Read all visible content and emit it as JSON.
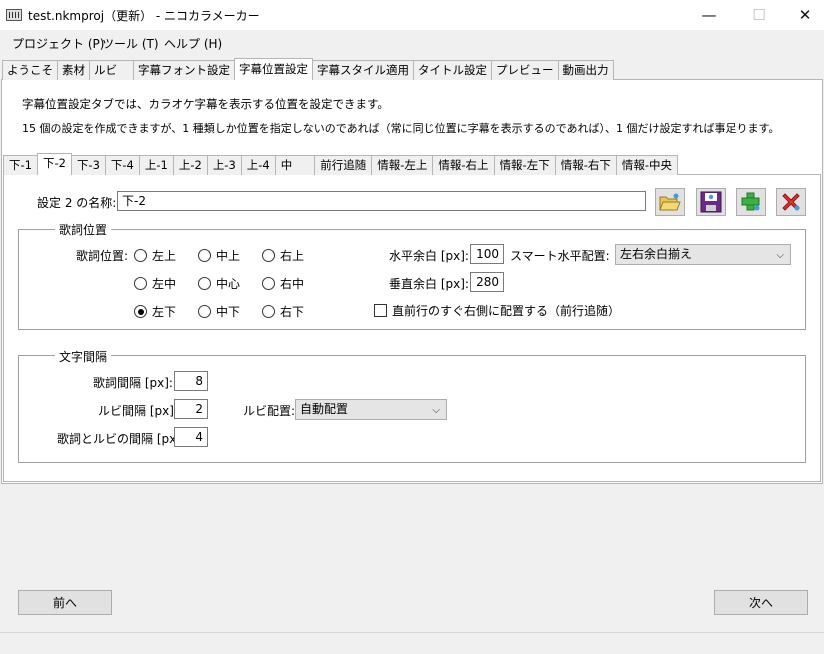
{
  "window": {
    "title": "test.nkmproj（更新） - ニコカラメーカー",
    "controls": {
      "minimize": "—",
      "maximize": "☐",
      "close": "✕"
    }
  },
  "menu": [
    "プロジェクト (P)",
    "ツール (T)",
    "ヘルプ (H)"
  ],
  "main_tabs": [
    "ようこそ",
    "素材",
    "ルビ",
    "字幕フォント設定",
    "字幕位置設定",
    "字幕スタイル適用",
    "タイトル設定",
    "プレビュー",
    "動画出力"
  ],
  "main_tab_active": "字幕位置設定",
  "description": {
    "line1": "字幕位置設定タブでは、カラオケ字幕を表示する位置を設定できます。",
    "line2": "15 個の設定を作成できますが、1 種類しか位置を指定しないのであれば（常に同じ位置に字幕を表示するのであれば）、1 個だけ設定すれば事足ります。"
  },
  "sub_tabs": [
    "下-1",
    "下-2",
    "下-3",
    "下-4",
    "上-1",
    "上-2",
    "上-3",
    "上-4",
    "中",
    "前行追随",
    "情報-左上",
    "情報-右上",
    "情報-左下",
    "情報-右下",
    "情報-中央"
  ],
  "sub_tab_active": "下-2",
  "setting": {
    "name_label": "設定 2 の名称:",
    "name_value": "下-2",
    "buttons": [
      "open-folder-icon",
      "save-disk-icon",
      "add-plus-icon",
      "delete-x-icon"
    ]
  },
  "lyrics_position": {
    "group_title": "歌詞位置",
    "position_label": "歌詞位置:",
    "radios": [
      {
        "label": "左上",
        "selected": false
      },
      {
        "label": "中上",
        "selected": false
      },
      {
        "label": "右上",
        "selected": false
      },
      {
        "label": "左中",
        "selected": false
      },
      {
        "label": "中心",
        "selected": false
      },
      {
        "label": "右中",
        "selected": false
      },
      {
        "label": "左下",
        "selected": true
      },
      {
        "label": "中下",
        "selected": false
      },
      {
        "label": "右下",
        "selected": false
      }
    ],
    "h_margin_label": "水平余白 [px]:",
    "h_margin_value": "100",
    "v_margin_label": "垂直余白 [px]:",
    "v_margin_value": "280",
    "smart_label": "スマート水平配置:",
    "smart_value": "左右余白揃え",
    "follow_label": "直前行のすぐ右側に配置する（前行追随）",
    "follow_checked": false
  },
  "spacing": {
    "group_title": "文字間隔",
    "lyrics_spacing_label": "歌詞間隔 [px]:",
    "lyrics_spacing_value": "8",
    "ruby_spacing_label": "ルビ間隔 [px]:",
    "ruby_spacing_value": "2",
    "ruby_placement_label": "ルビ配置:",
    "ruby_placement_value": "自動配置",
    "lyrics_ruby_spacing_label": "歌詞とルビの間隔 [px]:",
    "lyrics_ruby_spacing_value": "4"
  },
  "nav": {
    "prev": "前へ",
    "next": "次へ"
  }
}
